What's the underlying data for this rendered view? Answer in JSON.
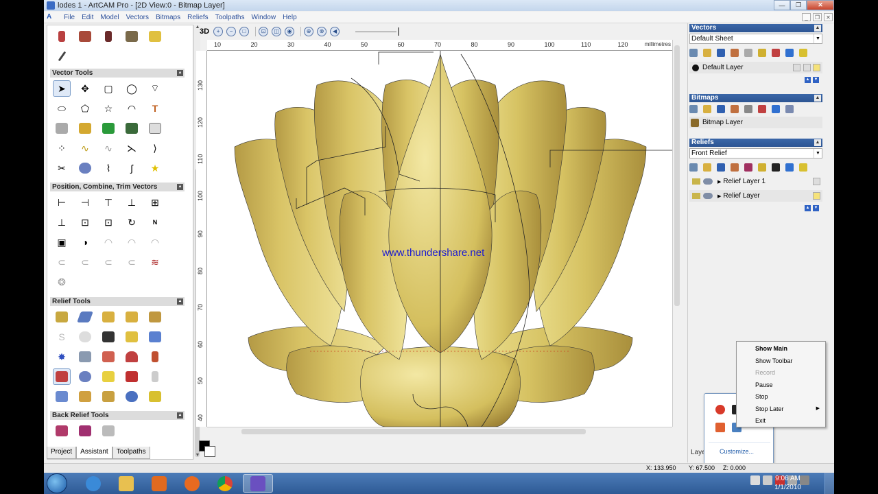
{
  "window": {
    "title": "lodes 1 - ArtCAM Pro - [2D View:0 - Bitmap Layer]"
  },
  "menu": [
    "File",
    "Edit",
    "Model",
    "Vectors",
    "Bitmaps",
    "Reliefs",
    "Toolpaths",
    "Window",
    "Help"
  ],
  "left_panel": {
    "sections": {
      "vector_tools": "Vector Tools",
      "position": "Position, Combine, Trim Vectors",
      "relief_tools": "Relief Tools",
      "back_relief": "Back Relief Tools"
    },
    "tabs": [
      "Project",
      "Assistant",
      "Toolpaths"
    ],
    "active_tab": "Assistant"
  },
  "view_toolbar": {
    "label_3d": "3D"
  },
  "ruler": {
    "top_labels": [
      "10",
      "20",
      "30",
      "40",
      "50",
      "60",
      "70",
      "80",
      "90",
      "100",
      "110",
      "120"
    ],
    "units": "millimetres",
    "left_labels": [
      "130",
      "120",
      "110",
      "100",
      "90",
      "80",
      "70",
      "60",
      "50",
      "40"
    ]
  },
  "canvas": {
    "watermark": "www.thundershare.net"
  },
  "right_panel": {
    "vectors": {
      "title": "Vectors",
      "sheet": "Default Sheet",
      "layer": "Default Layer"
    },
    "bitmaps": {
      "title": "Bitmaps",
      "layer": "Bitmap Layer"
    },
    "reliefs": {
      "title": "Reliefs",
      "relief": "Front Relief",
      "layers": [
        "Relief Layer 1",
        "Relief Layer"
      ]
    },
    "layers_tab": "Layers"
  },
  "context_menu": {
    "items": [
      {
        "label": "Show Main",
        "state": "bold"
      },
      {
        "label": "Show Toolbar",
        "state": "normal"
      },
      {
        "label": "Record",
        "state": "disabled"
      },
      {
        "label": "Pause",
        "state": "normal"
      },
      {
        "label": "Stop",
        "state": "normal"
      },
      {
        "label": "Stop Later",
        "state": "submenu"
      },
      {
        "label": "Exit",
        "state": "normal"
      }
    ]
  },
  "tray_popup": {
    "customize": "Customize..."
  },
  "statusbar": {
    "x": "X: 133.950",
    "y": "Y: 67.500",
    "z": "Z: 0.000"
  },
  "taskbar": {
    "time": "9:06 AM",
    "date": "1/1/2010"
  },
  "colors": {
    "relief_gold": "#d9c86a",
    "accent_blue": "#2d5593",
    "watermark": "#1a1ad2"
  }
}
